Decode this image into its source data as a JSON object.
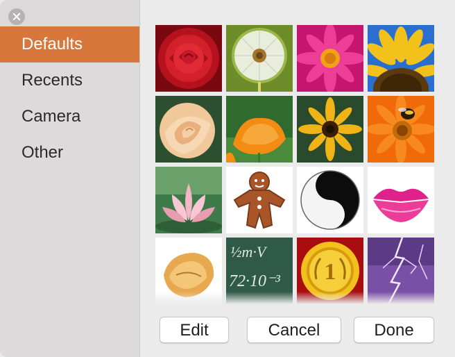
{
  "sidebar": {
    "items": [
      {
        "label": "Defaults",
        "selected": true
      },
      {
        "label": "Recents",
        "selected": false
      },
      {
        "label": "Camera",
        "selected": false
      },
      {
        "label": "Other",
        "selected": false
      }
    ]
  },
  "grid": {
    "images": [
      "red-rose",
      "dandelion",
      "pink-daisy",
      "sunflower",
      "peach-rose",
      "orange-poppy",
      "black-eyed-susan",
      "orange-gerbera-bee",
      "lotus",
      "gingerbread-man",
      "yin-yang",
      "pink-lips",
      "fortune-cookie",
      "chalkboard-math",
      "gold-medal",
      "purple-lightning"
    ]
  },
  "chalkboard": {
    "line1": "½m·V",
    "line2": "72·10⁻³"
  },
  "medal": {
    "number": "1"
  },
  "buttons": {
    "edit": "Edit",
    "cancel": "Cancel",
    "done": "Done"
  },
  "colors": {
    "accent": "#d8773b",
    "sidebar_bg": "#dcdadb",
    "window_bg": "#ecebec"
  }
}
